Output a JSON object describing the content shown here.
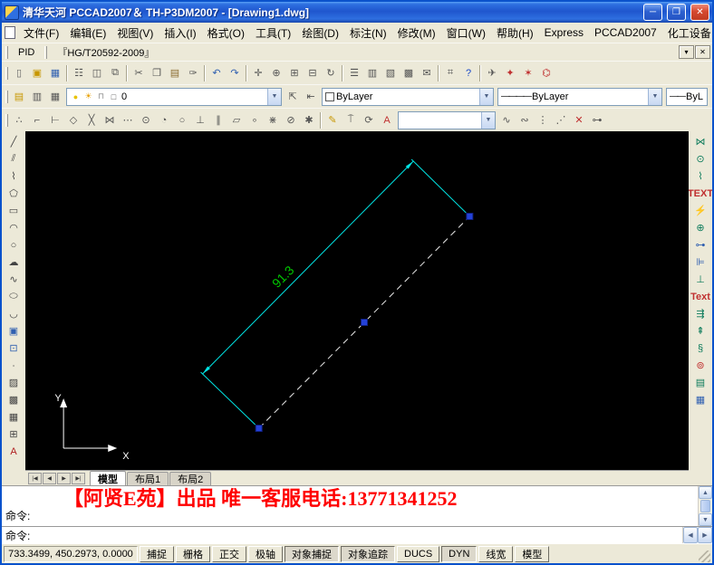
{
  "window": {
    "title": "清华天河 PCCAD2007＆ TH-P3DM2007 - [Drawing1.dwg]",
    "controls": {
      "minimize": "─",
      "maximize": "❐",
      "close": "✕"
    },
    "mdi": {
      "minimize": "─",
      "restore": "❐",
      "close": "✕"
    }
  },
  "menu": {
    "items": [
      {
        "id": "file",
        "label": "文件(F)"
      },
      {
        "id": "edit",
        "label": "编辑(E)"
      },
      {
        "id": "view",
        "label": "视图(V)"
      },
      {
        "id": "insert",
        "label": "插入(I)"
      },
      {
        "id": "format",
        "label": "格式(O)"
      },
      {
        "id": "tools",
        "label": "工具(T)"
      },
      {
        "id": "draw",
        "label": "绘图(D)"
      },
      {
        "id": "dimension",
        "label": "标注(N)"
      },
      {
        "id": "modify",
        "label": "修改(M)"
      },
      {
        "id": "window",
        "label": "窗口(W)"
      },
      {
        "id": "help",
        "label": "帮助(H)"
      },
      {
        "id": "express",
        "label": "Express"
      },
      {
        "id": "pccad2007",
        "label": "PCCAD2007"
      },
      {
        "id": "chem-equipment",
        "label": "化工设备"
      }
    ]
  },
  "pid_bar": {
    "pid_label": "PID",
    "standard_label": "『HG/T20592-2009』",
    "close_glyph": "✕",
    "options_glyph": "▾"
  },
  "toolbars": {
    "standard": [
      {
        "n": "new-icon",
        "g": "▯",
        "c": "#666666"
      },
      {
        "n": "open-icon",
        "g": "▣",
        "c": "#C79600"
      },
      {
        "n": "save-icon",
        "g": "▦",
        "c": "#2F5FB0"
      },
      {
        "sep": true
      },
      {
        "n": "plot-icon",
        "g": "☷",
        "c": "#555555"
      },
      {
        "n": "plot-preview-icon",
        "g": "◫",
        "c": "#555555"
      },
      {
        "n": "publish-icon",
        "g": "⧉",
        "c": "#555555"
      },
      {
        "sep": true
      },
      {
        "n": "cut-icon",
        "g": "✂",
        "c": "#555555"
      },
      {
        "n": "copy-icon",
        "g": "❐",
        "c": "#555555"
      },
      {
        "n": "paste-icon",
        "g": "▤",
        "c": "#8A6B2F"
      },
      {
        "n": "match-properties-icon",
        "g": "✑",
        "c": "#555555"
      },
      {
        "sep": true
      },
      {
        "n": "undo-icon",
        "g": "↶",
        "c": "#2F5FB0"
      },
      {
        "n": "redo-icon",
        "g": "↷",
        "c": "#2F5FB0"
      },
      {
        "sep": true
      },
      {
        "n": "pan-icon",
        "g": "✛",
        "c": "#555555"
      },
      {
        "n": "zoom-realtime-icon",
        "g": "⊕",
        "c": "#555555"
      },
      {
        "n": "zoom-window-icon",
        "g": "⊞",
        "c": "#555555"
      },
      {
        "n": "zoom-previous-icon",
        "g": "⊟",
        "c": "#555555"
      },
      {
        "n": "regen-icon",
        "g": "↻",
        "c": "#555555"
      },
      {
        "sep": true
      },
      {
        "n": "properties-icon",
        "g": "☰",
        "c": "#555555"
      },
      {
        "n": "designcenter-icon",
        "g": "▥",
        "c": "#555555"
      },
      {
        "n": "tool-palettes-icon",
        "g": "▧",
        "c": "#555555"
      },
      {
        "n": "sheet-set-manager-icon",
        "g": "▩",
        "c": "#555555"
      },
      {
        "n": "markup-set-manager-icon",
        "g": "✉",
        "c": "#555555"
      },
      {
        "sep": true
      },
      {
        "n": "quickcalc-icon",
        "g": "⌗",
        "c": "#555555"
      },
      {
        "n": "help-icon",
        "g": "?",
        "c": "#1847C8"
      },
      {
        "sep": true
      },
      {
        "n": "etransmit-icon",
        "g": "✈",
        "c": "#555555"
      },
      {
        "n": "express-tools-icon",
        "g": "✦",
        "c": "#C03030"
      },
      {
        "n": "pccad-tools-icon",
        "g": "✶",
        "c": "#C03030"
      },
      {
        "n": "chem-module-icon",
        "g": "⌬",
        "c": "#C03030"
      }
    ],
    "layer_tools": [
      {
        "n": "layer-properties-manager-icon",
        "g": "▤",
        "c": "#C79600"
      },
      {
        "n": "layer-filter-icon",
        "g": "▥",
        "c": "#555555"
      },
      {
        "n": "layer-states-manager-icon",
        "g": "▦",
        "c": "#555555"
      }
    ],
    "layer_combo": {
      "value": "0",
      "status": [
        {
          "n": "layer-on-bulb-icon",
          "g": "●",
          "c": "#E8C200"
        },
        {
          "n": "layer-thaw-sun-icon",
          "g": "☀",
          "c": "#E8A000"
        },
        {
          "n": "layer-unlock-icon",
          "g": "⊓",
          "c": "#8A8A8A"
        },
        {
          "n": "layer-color-swatch-icon",
          "g": "□",
          "c": "#555555"
        }
      ]
    },
    "layer_tools2": [
      {
        "n": "make-object-layer-current-icon",
        "g": "⇱",
        "c": "#555555"
      },
      {
        "n": "layer-previous-icon",
        "g": "⇤",
        "c": "#555555"
      }
    ],
    "color_combo": {
      "value": "ByLayer",
      "swatch": "#FFFFFF"
    },
    "linetype_combo": {
      "value": "ByLayer",
      "sample": "————"
    },
    "lineweight_combo": {
      "value": "ByL",
      "sample": "——"
    },
    "osnap": [
      {
        "n": "temporary-track-point-icon",
        "g": "∴",
        "c": "#555555"
      },
      {
        "n": "snap-from-icon",
        "g": "⌐",
        "c": "#555555"
      },
      {
        "n": "snap-endpoint-icon",
        "g": "⊢",
        "c": "#555555"
      },
      {
        "n": "snap-midpoint-icon",
        "g": "◇",
        "c": "#555555"
      },
      {
        "n": "snap-intersection-icon",
        "g": "╳",
        "c": "#555555"
      },
      {
        "n": "snap-apparent-intersection-icon",
        "g": "⋈",
        "c": "#555555"
      },
      {
        "n": "snap-extension-icon",
        "g": "⋯",
        "c": "#555555"
      },
      {
        "n": "snap-center-icon",
        "g": "⊙",
        "c": "#555555"
      },
      {
        "n": "snap-quadrant-icon",
        "g": "◔",
        "c": "#555555"
      },
      {
        "n": "snap-tangent-icon",
        "g": "○",
        "c": "#555555"
      },
      {
        "n": "snap-perpendicular-icon",
        "g": "⊥",
        "c": "#555555"
      },
      {
        "n": "snap-parallel-icon",
        "g": "∥",
        "c": "#555555"
      },
      {
        "n": "snap-insert-icon",
        "g": "▱",
        "c": "#555555"
      },
      {
        "n": "snap-node-icon",
        "g": "∘",
        "c": "#555555"
      },
      {
        "n": "snap-nearest-icon",
        "g": "⋇",
        "c": "#555555"
      },
      {
        "n": "snap-none-icon",
        "g": "⊘",
        "c": "#555555"
      },
      {
        "n": "osnap-settings-icon",
        "g": "✱",
        "c": "#555555"
      }
    ],
    "dim_tools": [
      {
        "n": "quick-dim-icon",
        "g": "✎",
        "c": "#C79600"
      },
      {
        "n": "dim-linear-icon",
        "g": "⍑",
        "c": "#555555"
      },
      {
        "n": "dim-update-icon",
        "g": "⟳",
        "c": "#555555"
      },
      {
        "n": "text-style-icon",
        "g": "A",
        "c": "#C03030"
      }
    ],
    "style_combo": {
      "value": ""
    },
    "modify2": [
      {
        "n": "polyline-edit-icon",
        "g": "∿",
        "c": "#555555"
      },
      {
        "n": "spline-edit-icon",
        "g": "∾",
        "c": "#555555"
      },
      {
        "n": "divide-icon",
        "g": "⋮",
        "c": "#555555"
      },
      {
        "n": "measure-icon",
        "g": "⋰",
        "c": "#555555"
      },
      {
        "n": "break-point-icon",
        "g": "✕",
        "c": "#C03030"
      },
      {
        "n": "join-icon",
        "g": "⊶",
        "c": "#555555"
      }
    ]
  },
  "left_toolbar": [
    {
      "n": "line-icon",
      "g": "╱",
      "c": "#444444"
    },
    {
      "n": "construction-line-icon",
      "g": "⫽",
      "c": "#444444"
    },
    {
      "n": "polyline-icon",
      "g": "⌇",
      "c": "#444444"
    },
    {
      "n": "polygon-icon",
      "g": "⬠",
      "c": "#444444"
    },
    {
      "n": "rectangle-icon",
      "g": "▭",
      "c": "#444444"
    },
    {
      "n": "arc-icon",
      "g": "◠",
      "c": "#444444"
    },
    {
      "n": "circle-icon",
      "g": "○",
      "c": "#444444"
    },
    {
      "n": "revision-cloud-icon",
      "g": "☁",
      "c": "#444444"
    },
    {
      "n": "spline-icon",
      "g": "∿",
      "c": "#444444"
    },
    {
      "n": "ellipse-icon",
      "g": "⬭",
      "c": "#444444"
    },
    {
      "n": "ellipse-arc-icon",
      "g": "◡",
      "c": "#444444"
    },
    {
      "n": "insert-block-icon",
      "g": "▣",
      "c": "#2F5FB0"
    },
    {
      "n": "make-block-icon",
      "g": "⊡",
      "c": "#2F5FB0"
    },
    {
      "n": "point-icon",
      "g": "∙",
      "c": "#444444"
    },
    {
      "n": "hatch-icon",
      "g": "▨",
      "c": "#444444"
    },
    {
      "n": "gradient-icon",
      "g": "▩",
      "c": "#444444"
    },
    {
      "n": "region-icon",
      "g": "▦",
      "c": "#444444"
    },
    {
      "n": "table-icon",
      "g": "⊞",
      "c": "#444444"
    },
    {
      "n": "mtext-icon",
      "g": "A",
      "c": "#B02020"
    }
  ],
  "right_toolbar": [
    {
      "n": "pid-valve-icon",
      "g": "⋈",
      "c": "#0A7A5A"
    },
    {
      "n": "pid-pump-icon",
      "g": "⊙",
      "c": "#0A7A5A"
    },
    {
      "n": "pipe-line-icon",
      "g": "⌇",
      "c": "#0A7A5A"
    },
    {
      "n": "text-annotation-icon",
      "g": "TEXT",
      "c": "#C03030"
    },
    {
      "n": "weld-symbol-icon",
      "g": "⚡",
      "c": "#2F5FB0"
    },
    {
      "n": "equipment-icon",
      "g": "⊕",
      "c": "#0A7A5A"
    },
    {
      "n": "nozzle-icon",
      "g": "⊶",
      "c": "#2F5FB0"
    },
    {
      "n": "flange-icon",
      "g": "⊫",
      "c": "#2F5FB0"
    },
    {
      "n": "support-icon",
      "g": "⊥",
      "c": "#0A7A5A"
    },
    {
      "n": "text-edit-icon",
      "g": "Text",
      "c": "#C03030"
    },
    {
      "n": "dim-chain-icon",
      "g": "⇶",
      "c": "#0A7A5A"
    },
    {
      "n": "level-mark-icon",
      "g": "⇞",
      "c": "#0A7A5A"
    },
    {
      "n": "section-symbol-icon",
      "g": "§",
      "c": "#0A7A5A"
    },
    {
      "n": "balloon-icon",
      "g": "⊚",
      "c": "#C03030"
    },
    {
      "n": "parts-list-icon",
      "g": "▤",
      "c": "#0A7A5A"
    },
    {
      "n": "title-block-icon",
      "g": "▦",
      "c": "#2F5FB0"
    }
  ],
  "canvas": {
    "dimension_text": "91.3",
    "ucs_x": "X",
    "ucs_y": "Y",
    "colors": {
      "dimension_line": "#00E5E5",
      "dimension_text": "#00C800",
      "grip": "#2442D8",
      "selected_line": "#E8E8E8",
      "background": "#000000"
    }
  },
  "tabs": {
    "nav": [
      {
        "n": "first-layout-tab-button",
        "g": "|◀"
      },
      {
        "n": "previous-layout-tab-button",
        "g": "◀"
      },
      {
        "n": "next-layout-tab-button",
        "g": "▶"
      },
      {
        "n": "last-layout-tab-button",
        "g": "▶|"
      }
    ],
    "items": [
      {
        "id": "model",
        "label": "模型",
        "active": true
      },
      {
        "id": "layout1",
        "label": "布局1",
        "active": false
      },
      {
        "id": "layout2",
        "label": "布局2",
        "active": false
      }
    ]
  },
  "command": {
    "banner": "【阿贤E苑】出品 唯一客服电话:13771341252",
    "history_line": "命令:",
    "prompt": "命令:",
    "scroll": {
      "up": "▲",
      "down": "▼",
      "left": "◀",
      "right": "▶"
    }
  },
  "status_bar": {
    "coordinates": "733.3499, 450.2973, 0.0000",
    "buttons": [
      {
        "id": "snap",
        "label": "捕捉",
        "active": false
      },
      {
        "id": "grid",
        "label": "栅格",
        "active": false
      },
      {
        "id": "ortho",
        "label": "正交",
        "active": false
      },
      {
        "id": "polar",
        "label": "极轴",
        "active": false
      },
      {
        "id": "osnap",
        "label": "对象捕捉",
        "active": true
      },
      {
        "id": "otrack",
        "label": "对象追踪",
        "active": true
      },
      {
        "id": "ducs",
        "label": "DUCS",
        "active": false
      },
      {
        "id": "dyn",
        "label": "DYN",
        "active": true
      },
      {
        "id": "lwt",
        "label": "线宽",
        "active": false
      },
      {
        "id": "model-space",
        "label": "模型",
        "active": false
      }
    ]
  },
  "ui": {
    "dropdown_arrow": "▼"
  }
}
